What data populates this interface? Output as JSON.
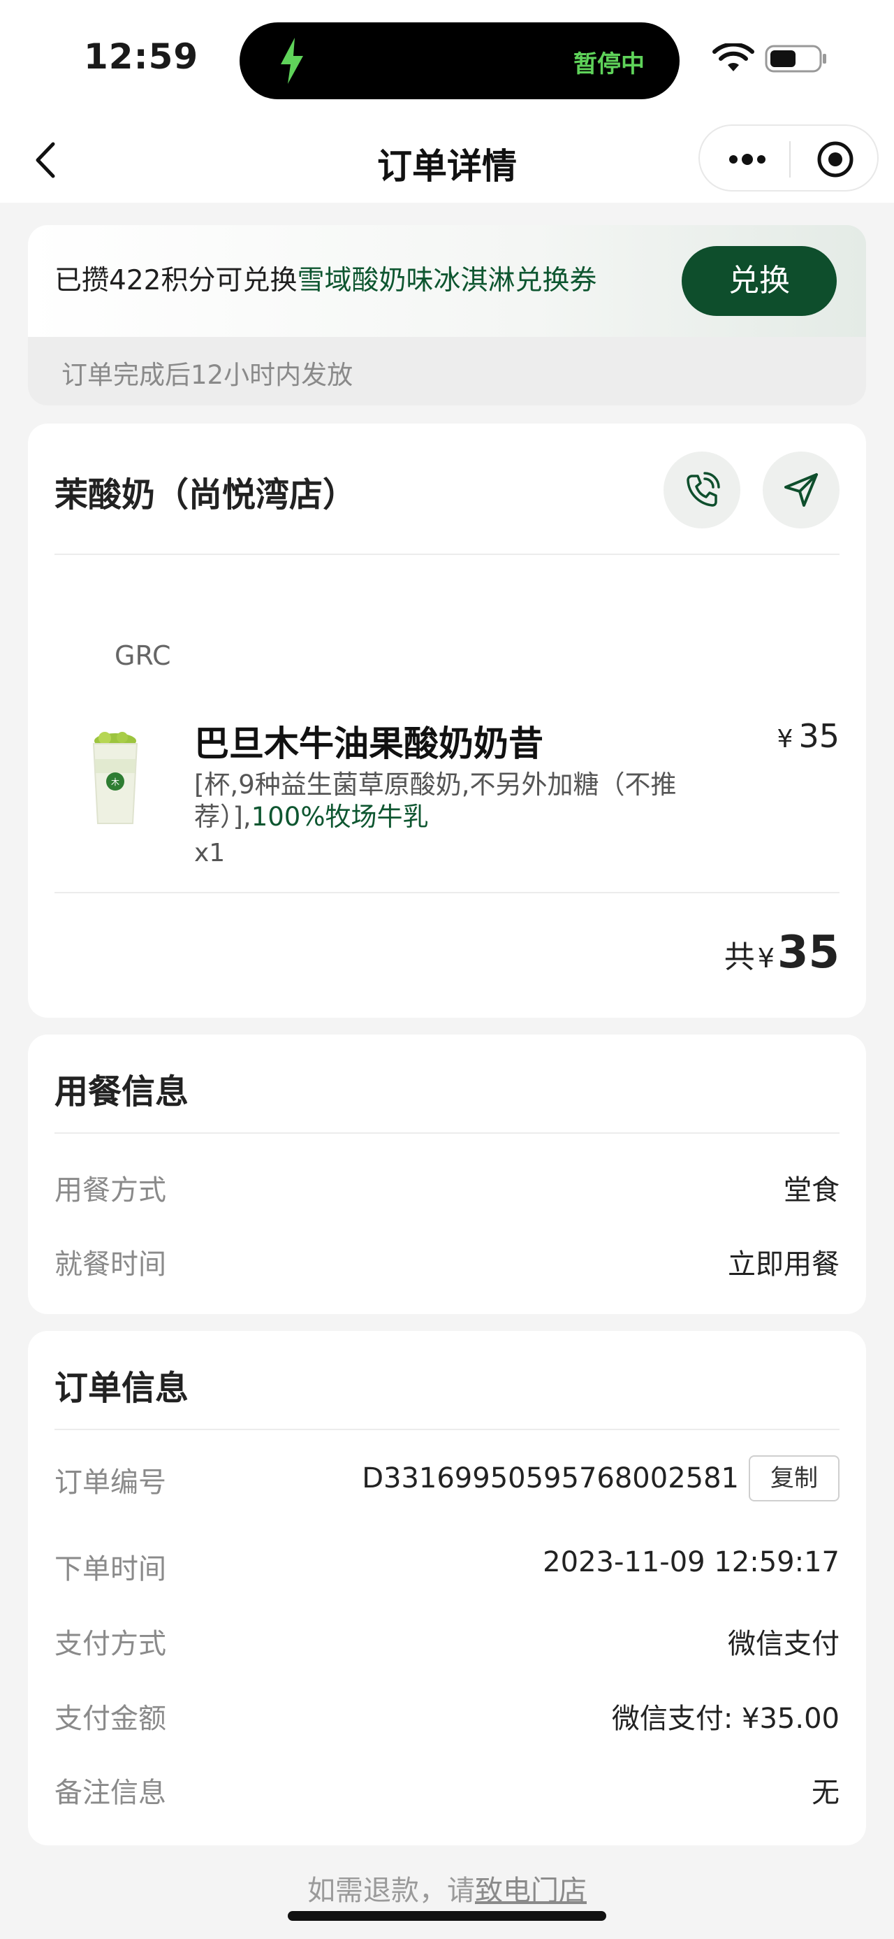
{
  "status_bar": {
    "time": "12:59",
    "island_text": "暂停中"
  },
  "nav": {
    "title": "订单详情"
  },
  "points_banner": {
    "text_prefix": "已攒422积分可兑换",
    "text_highlight": "雪域酸奶味冰淇淋兑换券",
    "redeem_label": "兑换",
    "note": "订单完成后12小时内发放"
  },
  "order": {
    "store_name": "茉酸奶（尚悦湾店）",
    "brand_tag": "GRC",
    "items": [
      {
        "name": "巴旦木牛油果酸奶奶昔",
        "price_symbol": "¥",
        "price": "35",
        "options_plain": "[杯,9种益生菌草原酸奶,不另外加糖（不推荐）],",
        "options_highlight": "100%牧场牛乳",
        "quantity": "x1"
      }
    ],
    "total_prefix": "共",
    "total_symbol": "¥",
    "total_amount": "35"
  },
  "dining": {
    "title": "用餐信息",
    "rows": [
      {
        "label": "用餐方式",
        "value": "堂食"
      },
      {
        "label": "就餐时间",
        "value": "立即用餐"
      }
    ]
  },
  "order_info": {
    "title": "订单信息",
    "order_number_label": "订单编号",
    "order_number": "D3316995059576800258​1",
    "copy_label": "复制",
    "rows": [
      {
        "label": "下单时间",
        "value": "2023-11-09 12:59:17"
      },
      {
        "label": "支付方式",
        "value": "微信支付"
      },
      {
        "label": "支付金额",
        "value": "微信支付: ¥35.00"
      },
      {
        "label": "备注信息",
        "value": "无"
      }
    ]
  },
  "footer": {
    "refund_prefix": "如需退款，请",
    "refund_link": "致电门店"
  },
  "colors": {
    "brand_green": "#0e4e2c",
    "text_green": "#0e5630",
    "island_green": "#5fd35a"
  }
}
